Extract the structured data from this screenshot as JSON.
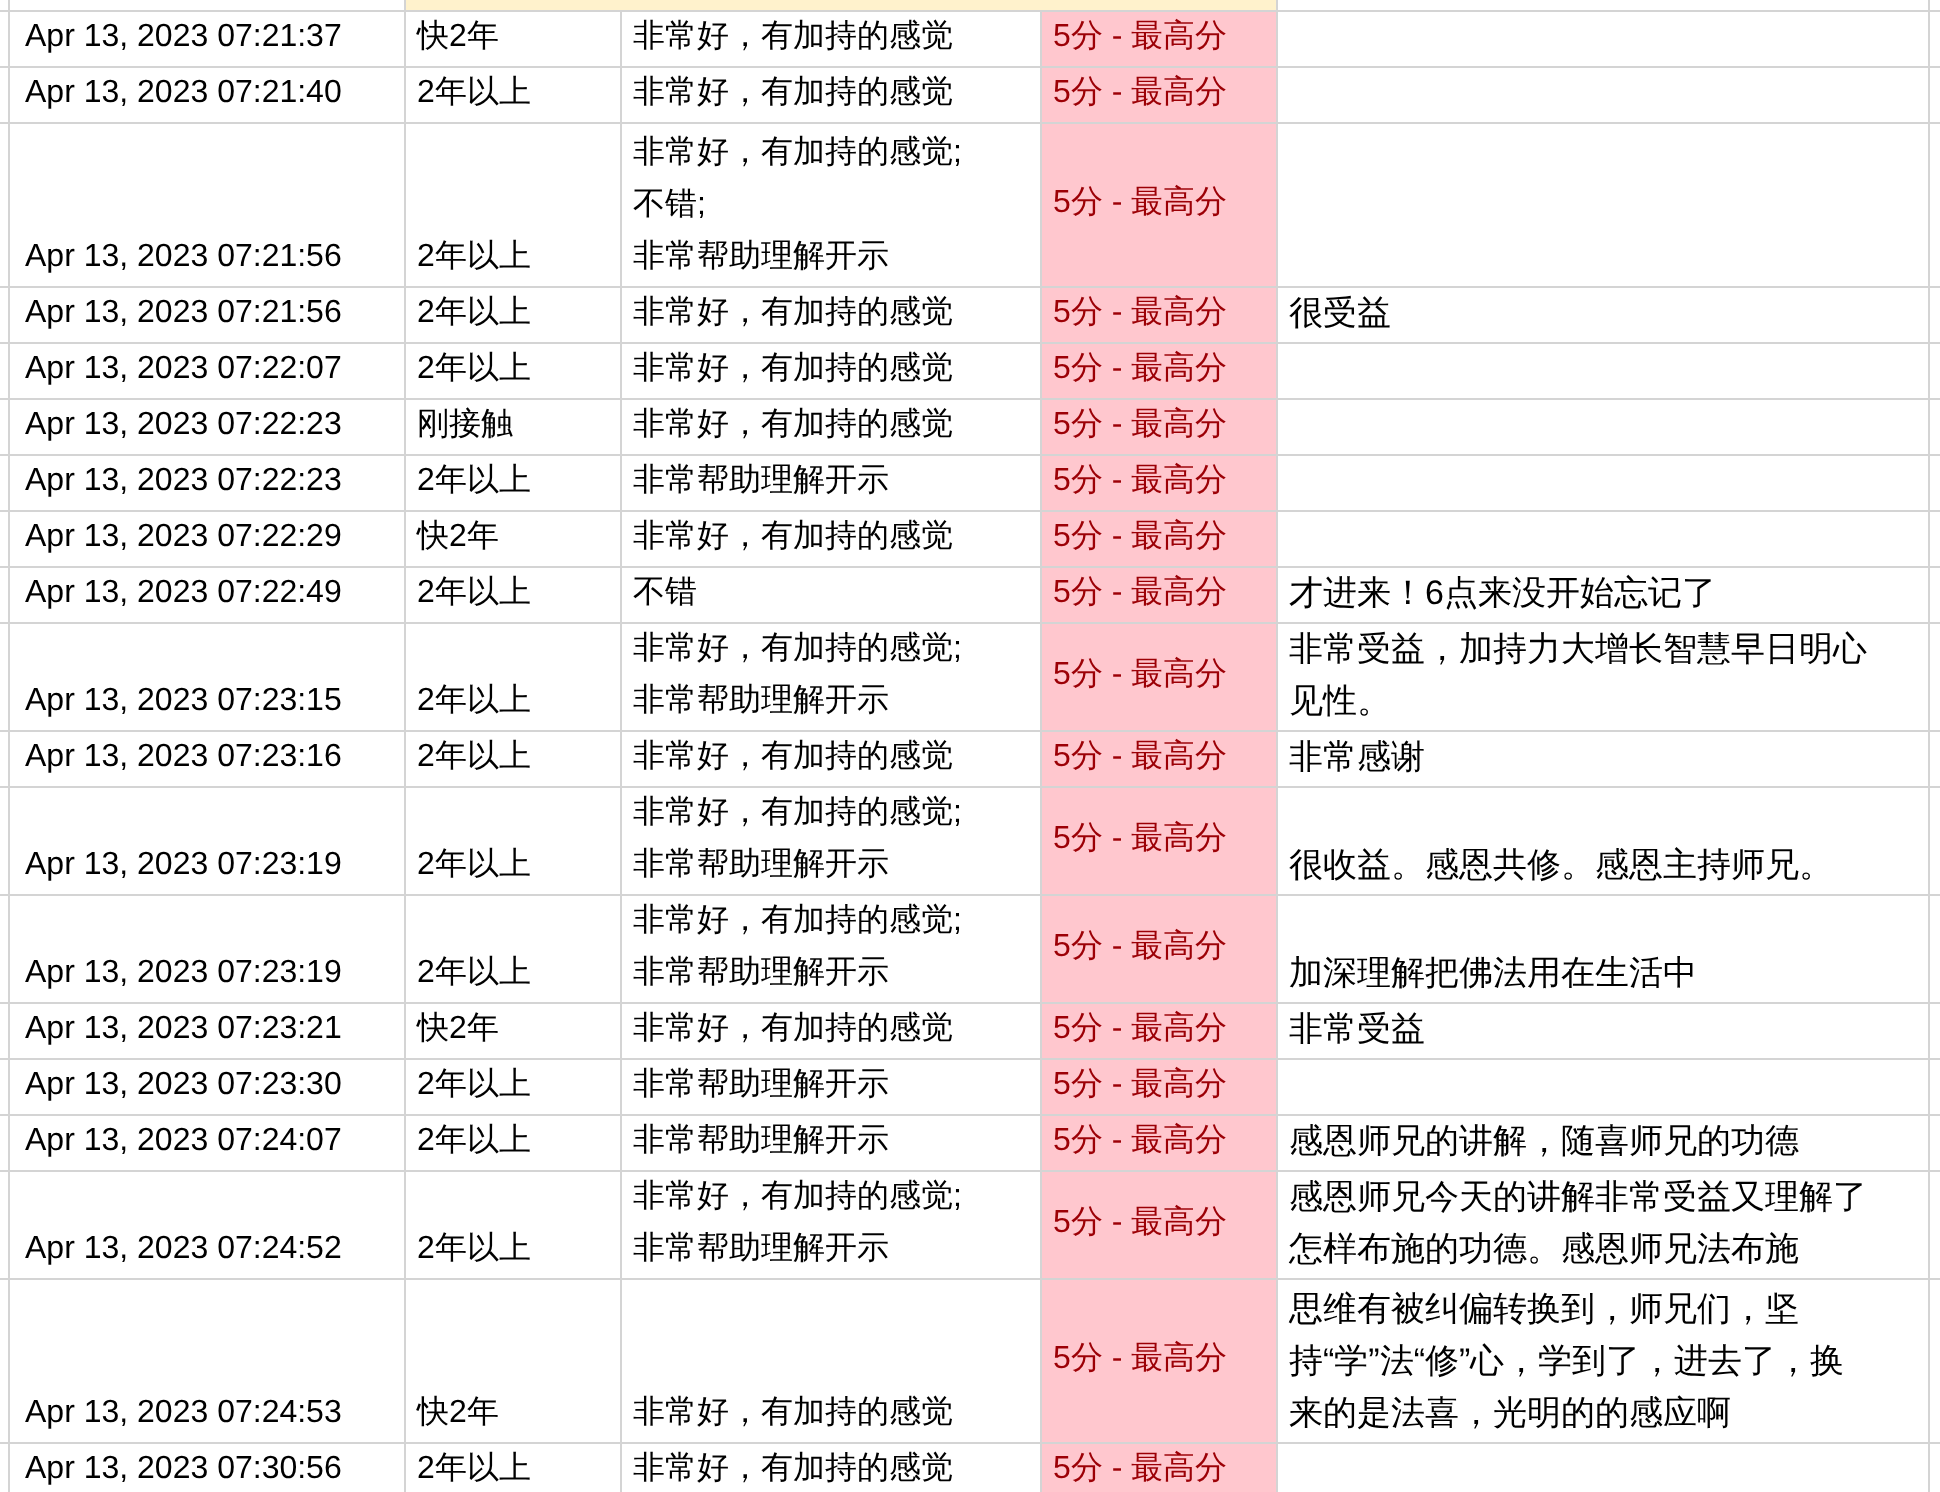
{
  "table": {
    "rows": [
      {
        "time": "Apr 13, 2023 07:21:37",
        "experience": "快2年",
        "feeling": "非常好，有加持的感觉",
        "score": "5分 - 最高分"
      },
      {
        "time": "Apr 13, 2023 07:21:40",
        "experience": "2年以上",
        "feeling": "非常好，有加持的感觉",
        "score": "5分 - 最高分"
      },
      {
        "time": "Apr 13, 2023 07:21:56",
        "experience": "2年以上",
        "feeling": "非常好，有加持的感觉;\n不错;\n非常帮助理解开示",
        "score": "5分 - 最高分"
      },
      {
        "time": "Apr 13, 2023 07:21:56",
        "experience": "2年以上",
        "feeling": "非常好，有加持的感觉",
        "score": "5分 - 最高分",
        "comment": "很受益"
      },
      {
        "time": "Apr 13, 2023 07:22:07",
        "experience": "2年以上",
        "feeling": "非常好，有加持的感觉",
        "score": "5分 - 最高分"
      },
      {
        "time": "Apr 13, 2023 07:22:23",
        "experience": "刚接触",
        "feeling": "非常好，有加持的感觉",
        "score": "5分 - 最高分"
      },
      {
        "time": "Apr 13, 2023 07:22:23",
        "experience": "2年以上",
        "feeling": "非常帮助理解开示",
        "score": "5分 - 最高分"
      },
      {
        "time": "Apr 13, 2023 07:22:29",
        "experience": "快2年",
        "feeling": "非常好，有加持的感觉",
        "score": "5分 - 最高分"
      },
      {
        "time": "Apr 13, 2023 07:22:49",
        "experience": "2年以上",
        "feeling": "不错",
        "score": "5分 - 最高分",
        "comment": "才进来！6点来没开始忘记了"
      },
      {
        "time": "Apr 13, 2023 07:23:15",
        "experience": "2年以上",
        "feeling": "非常好，有加持的感觉;\n非常帮助理解开示",
        "score": "5分 - 最高分",
        "comment": "非常受益，加持力大增长智慧早日明心见性。"
      },
      {
        "time": "Apr 13, 2023 07:23:16",
        "experience": "2年以上",
        "feeling": "非常好，有加持的感觉",
        "score": "5分 - 最高分",
        "comment": "非常感谢"
      },
      {
        "time": "Apr 13, 2023 07:23:19",
        "experience": "2年以上",
        "feeling": "非常好，有加持的感觉;\n非常帮助理解开示",
        "score": "5分 - 最高分",
        "comment": "很收益。感恩共修。感恩主持师兄。"
      },
      {
        "time": "Apr 13, 2023 07:23:19",
        "experience": "2年以上",
        "feeling": "非常好，有加持的感觉;\n非常帮助理解开示",
        "score": "5分 - 最高分",
        "comment": "加深理解把佛法用在生活中"
      },
      {
        "time": "Apr 13, 2023 07:23:21",
        "experience": "快2年",
        "feeling": "非常好，有加持的感觉",
        "score": "5分 - 最高分",
        "comment": "非常受益"
      },
      {
        "time": "Apr 13, 2023 07:23:30",
        "experience": "2年以上",
        "feeling": "非常帮助理解开示",
        "score": "5分 - 最高分"
      },
      {
        "time": "Apr 13, 2023 07:24:07",
        "experience": "2年以上",
        "feeling": "非常帮助理解开示",
        "score": "5分 - 最高分",
        "comment": "感恩师兄的讲解，随喜师兄的功德"
      },
      {
        "time": "Apr 13, 2023 07:24:52",
        "experience": "2年以上",
        "feeling": "非常好，有加持的感觉;\n非常帮助理解开示",
        "score": "5分 - 最高分",
        "comment": "感恩师兄今天的讲解非常受益又理解了怎样布施的功德。感恩师兄法布施"
      },
      {
        "time": "Apr 13, 2023 07:24:53",
        "experience": "快2年",
        "feeling": "非常好，有加持的感觉",
        "score": "5分 - 最高分",
        "comment": "思维有被纠偏转换到，师兄们，坚持“学”法“修”心，学到了，进去了，换来的是法喜，光明的的感应啊"
      },
      {
        "time": "Apr 13, 2023 07:30:56",
        "experience": "2年以上",
        "feeling": "非常好，有加持的感觉",
        "score": "5分 - 最高分"
      }
    ]
  }
}
